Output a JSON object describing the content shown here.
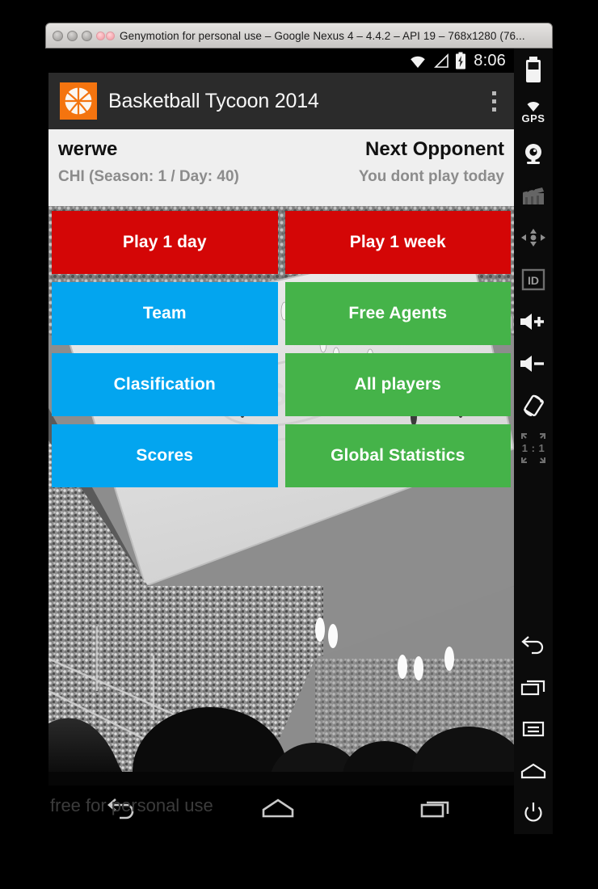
{
  "host_window": {
    "title": "Genymotion for personal use – Google Nexus 4 – 4.4.2 – API 19 – 768x1280 (76...",
    "buttons": [
      "close-button",
      "minimize-button",
      "zoom-button"
    ],
    "extra_dots": [
      "pink-dot-1",
      "pink-dot-2"
    ]
  },
  "android_status_bar": {
    "wifi_icon": "wifi-icon",
    "signal_icon": "signal-triangle-icon",
    "battery_icon": "battery-charging-icon",
    "clock": "8:06"
  },
  "action_bar": {
    "app_icon": "basketball-app-icon",
    "title": "Basketball Tycoon 2014",
    "overflow_icon": "overflow-menu-icon",
    "background": "#2b2b2b",
    "icon_background": "#f4740f"
  },
  "info_strip": {
    "team_name": "werwe",
    "team_details": "CHI (Season: 1 / Day: 40)",
    "next_opponent_label": "Next Opponent",
    "next_opponent_value": "You dont play today"
  },
  "menu_grid": {
    "rows": [
      [
        {
          "label": "Play 1 day",
          "color": "#d40606",
          "style": "btn-red"
        },
        {
          "label": "Play 1 week",
          "color": "#d40606",
          "style": "btn-red"
        }
      ],
      [
        {
          "label": "Team",
          "color": "#03a5ef",
          "style": "btn-blue"
        },
        {
          "label": "Free Agents",
          "color": "#45b349",
          "style": "btn-green"
        }
      ],
      [
        {
          "label": "Clasification",
          "color": "#03a5ef",
          "style": "btn-blue"
        },
        {
          "label": "All players",
          "color": "#45b349",
          "style": "btn-green"
        }
      ],
      [
        {
          "label": "Scores",
          "color": "#03a5ef",
          "style": "btn-blue"
        },
        {
          "label": "Global Statistics",
          "color": "#45b349",
          "style": "btn-green"
        }
      ]
    ]
  },
  "background_photo": {
    "description": "black-and-white photo of a basketball arena crowd and court"
  },
  "android_nav_bar": {
    "items": [
      "back-nav-icon",
      "home-nav-icon",
      "recents-nav-icon"
    ]
  },
  "watermark": "free for personal use",
  "genymotion_toolbar": {
    "items": [
      "battery-widget-icon",
      "gps-widget-icon",
      "camera-widget-icon",
      "video-recorder-icon",
      "dpad-icon",
      "identifiers-icon",
      "volume-up-icon",
      "volume-down-icon",
      "rotate-screen-icon",
      "scale-one-to-one-icon",
      "back-button-icon",
      "recents-button-icon",
      "menu-button-icon",
      "home-button-icon",
      "power-button-icon"
    ],
    "gps_label": "GPS",
    "scale_label": "1 : 1"
  }
}
